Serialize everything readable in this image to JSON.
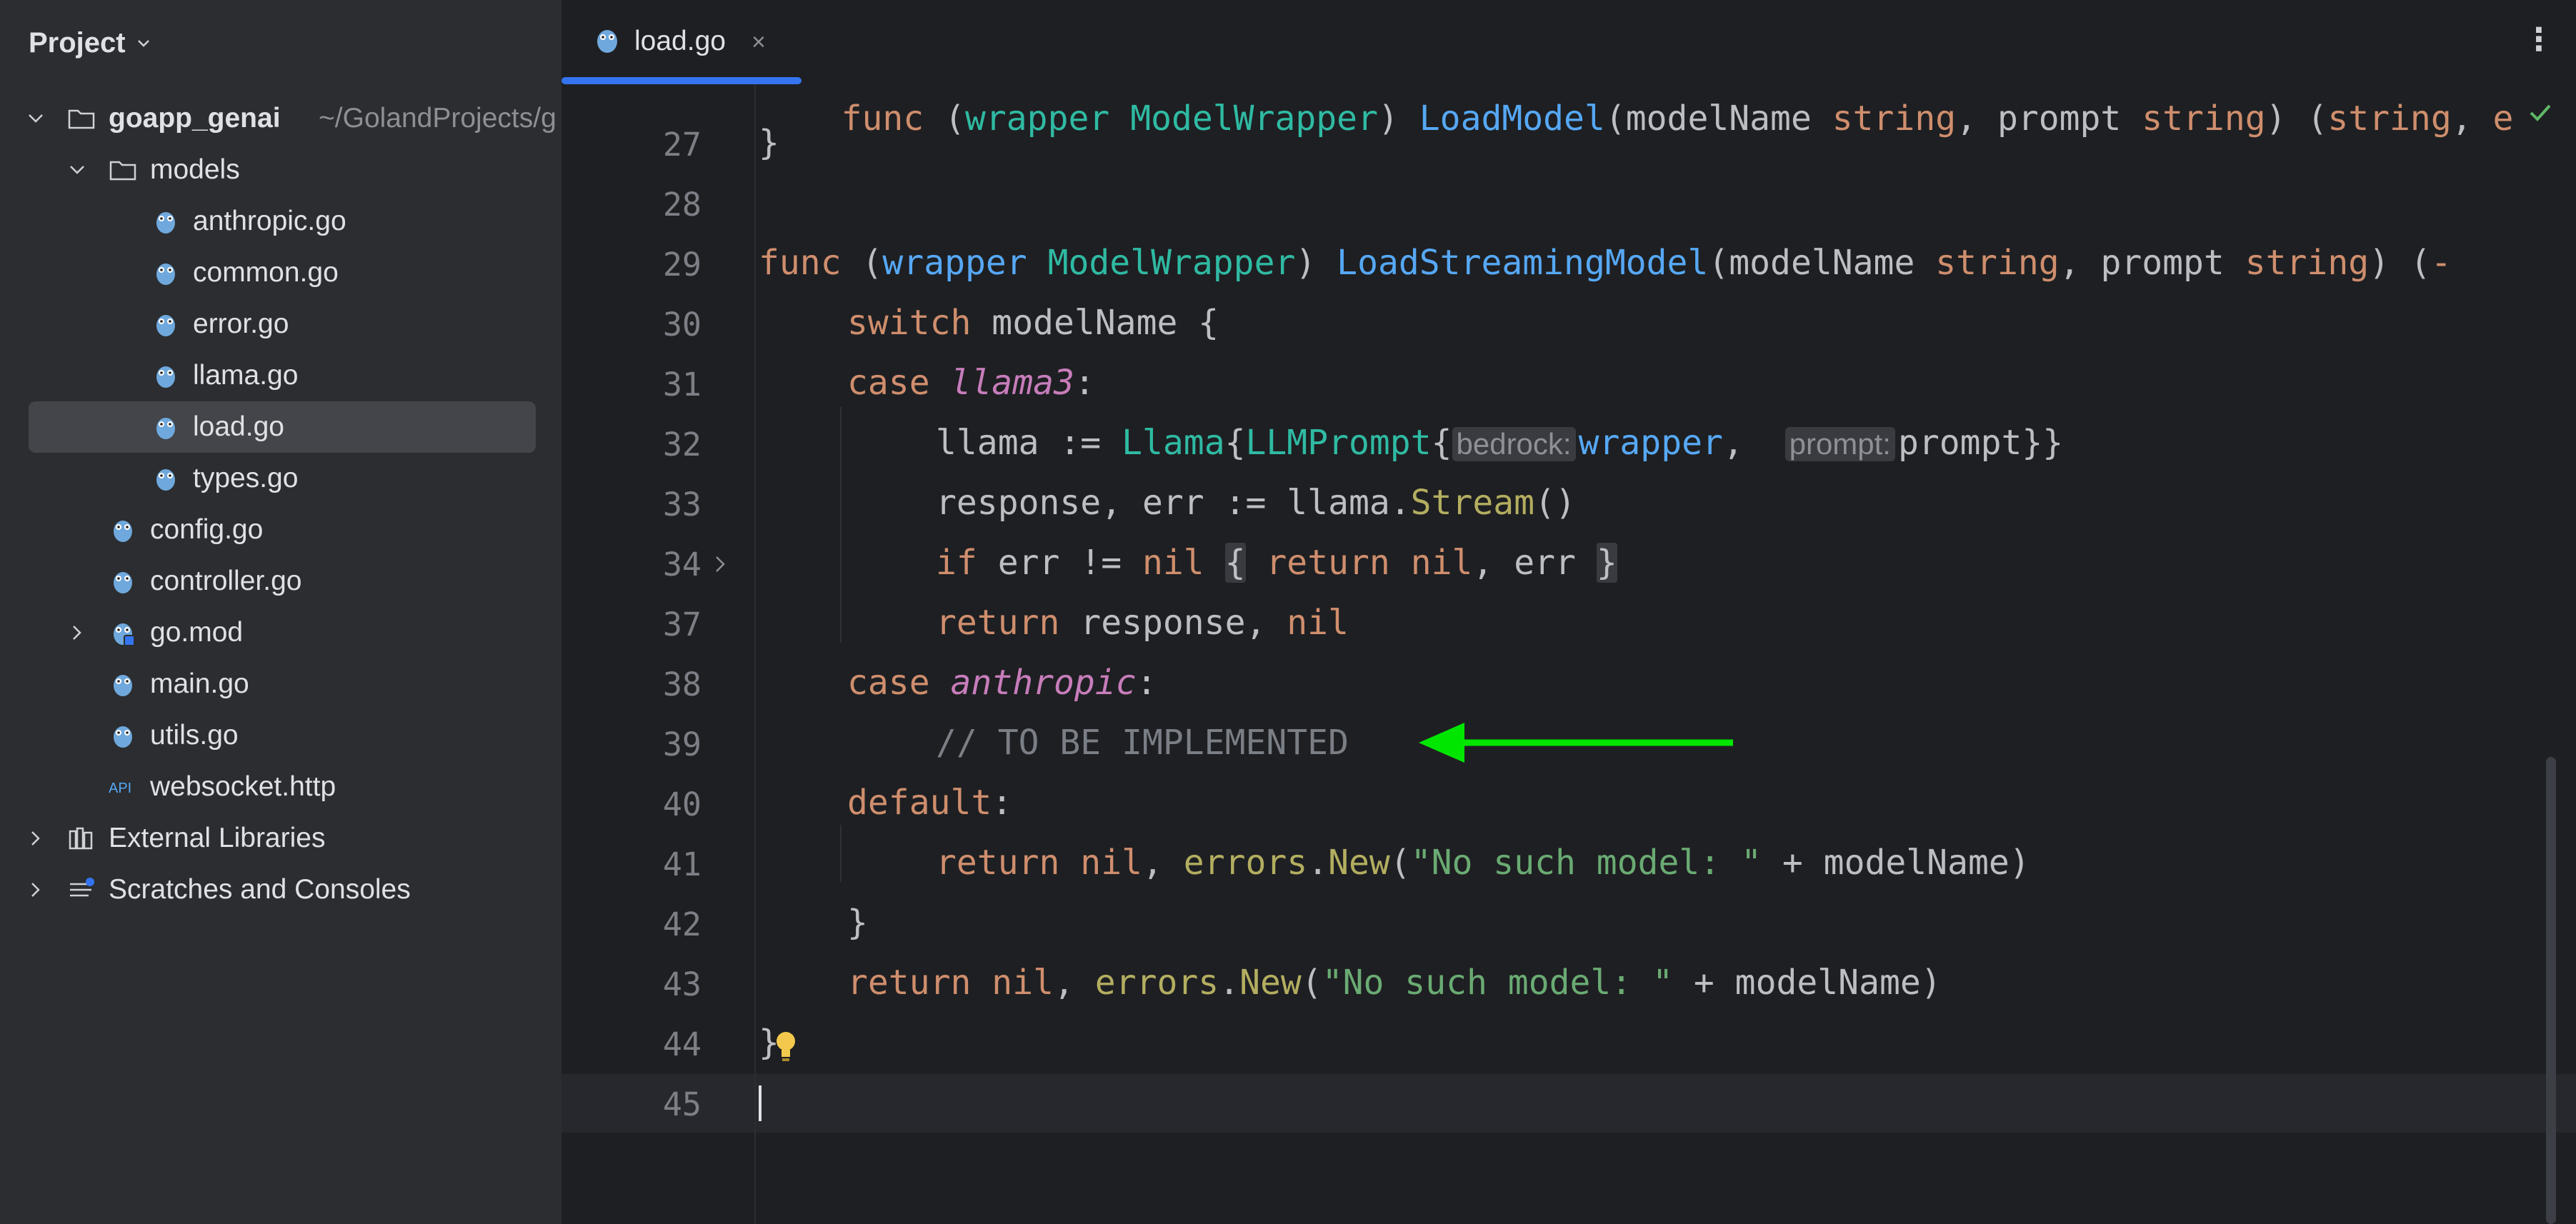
{
  "sidebar": {
    "title": "Project",
    "tree": [
      {
        "label": "goapp_genai",
        "hint": "~/GolandProjects/g",
        "icon": "folder-icon",
        "expanded": true,
        "depth": 0
      },
      {
        "label": "models",
        "icon": "folder-icon",
        "expanded": true,
        "depth": 1
      },
      {
        "label": "anthropic.go",
        "icon": "go-file-icon",
        "depth": 2
      },
      {
        "label": "common.go",
        "icon": "go-file-icon",
        "depth": 2
      },
      {
        "label": "error.go",
        "icon": "go-file-icon",
        "depth": 2
      },
      {
        "label": "llama.go",
        "icon": "go-file-icon",
        "depth": 2
      },
      {
        "label": "load.go",
        "icon": "go-file-icon",
        "depth": 2,
        "selected": true
      },
      {
        "label": "types.go",
        "icon": "go-file-icon",
        "depth": 2
      },
      {
        "label": "config.go",
        "icon": "go-file-icon",
        "depth": 1
      },
      {
        "label": "controller.go",
        "icon": "go-file-icon",
        "depth": 1
      },
      {
        "label": "go.mod",
        "icon": "go-mod-icon",
        "depth": 1,
        "collapsed": true
      },
      {
        "label": "main.go",
        "icon": "go-file-icon",
        "depth": 1
      },
      {
        "label": "utils.go",
        "icon": "go-file-icon",
        "depth": 1
      },
      {
        "label": "websocket.http",
        "icon": "http-api-icon",
        "icon_text": "API",
        "depth": 1
      },
      {
        "label": "External Libraries",
        "icon": "library-icon",
        "depth": 0,
        "collapsed": true
      },
      {
        "label": "Scratches and Consoles",
        "icon": "scratches-icon",
        "depth": 0,
        "collapsed": true
      }
    ]
  },
  "editor": {
    "tab": {
      "label": "load.go",
      "close": "×"
    },
    "menu": "⋮",
    "lines": [
      {
        "num": "",
        "partial_top": true
      },
      {
        "num": "27"
      },
      {
        "num": "28"
      },
      {
        "num": "29"
      },
      {
        "num": "30"
      },
      {
        "num": "31"
      },
      {
        "num": "32"
      },
      {
        "num": "33"
      },
      {
        "num": "34"
      },
      {
        "num": "37"
      },
      {
        "num": "38"
      },
      {
        "num": "39"
      },
      {
        "num": "40"
      },
      {
        "num": "41"
      },
      {
        "num": "42"
      },
      {
        "num": "43"
      },
      {
        "num": "44"
      },
      {
        "num": "45"
      }
    ],
    "code": {
      "l26": "func (wrapper ModelWrapper) LoadModel(modelName string, prompt string) (string, e",
      "l27": "}",
      "l29a": "func",
      "l29b": "wrapper",
      "l29c": "ModelWrapper",
      "l29d": "LoadStreamingModel",
      "l29e": "modelName",
      "l29f": "string",
      "l29g": "prompt",
      "l29h": "string",
      "l30a": "switch",
      "l30b": " modelName {",
      "l31a": "case",
      "l31b": "llama3",
      "l32a": "llama := ",
      "l32b": "Llama",
      "l32c": "LLMPrompt",
      "l32_hint1": "bedrock:",
      "l32d": "wrapper",
      "l32_hint2": "prompt:",
      "l32e": "prompt}}",
      "l33a": "response, err := llama.",
      "l33b": "Stream",
      "l33c": "()",
      "l34a": "if",
      "l34b": " err != ",
      "l34c": "nil",
      "l34d": "return",
      "l34e": "nil",
      "l34f": ", err",
      "l37a": "return",
      "l37b": " response, ",
      "l37c": "nil",
      "l38a": "case",
      "l38b": "anthropic",
      "l39": "// TO BE IMPLEMENTED",
      "l40": "default",
      "l41a": "return",
      "l41b": "nil",
      "l41c": "errors",
      "l41d": "New",
      "l41e": "\"No such model: \"",
      "l41f": " + modelName)",
      "l42": "}",
      "l43a": "return",
      "l43b": "nil",
      "l43c": "errors",
      "l43d": "New",
      "l43e": "\"No such model: \"",
      "l43f": " + modelName)",
      "l44": "}"
    },
    "annotation_color": "#00e600",
    "status_ok_icon": "checkmark-icon"
  },
  "colors": {
    "keyword": "#cf8e6d",
    "function": "#56a8f5",
    "type": "#2fbaa3",
    "string": "#6aab73",
    "comment": "#7a7e85",
    "accent": "#3574f0"
  }
}
